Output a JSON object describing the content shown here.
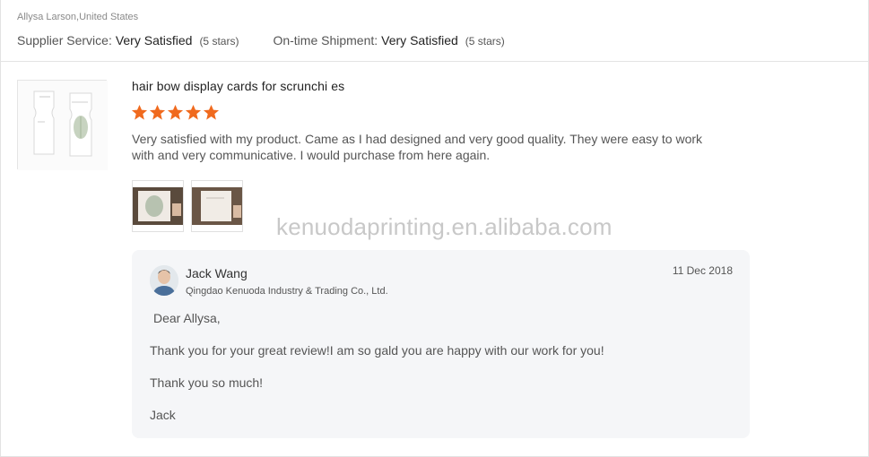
{
  "review": {
    "reviewer": "Allysa Larson,United States",
    "supplier_service_label": "Supplier Service:",
    "supplier_service_value": "Very Satisfied",
    "supplier_service_stars": "(5 stars)",
    "shipment_label": "On-time Shipment:",
    "shipment_value": "Very Satisfied",
    "shipment_stars": "(5 stars)",
    "product_title": "hair bow display cards for scrunchi es",
    "rating": 5,
    "text": "Very satisfied with my product. Came as I had designed and very good quality. They were easy to work with and very communicative. I would purchase from here again.",
    "star_color": "#f06a1e",
    "photo_count": 2
  },
  "watermark": "KENUODAPRINTING.EN.ALIBABA.COM",
  "watermark_text": "kenuodaprinting.en.alibaba.com",
  "reply": {
    "name": "Jack Wang",
    "company": "Qingdao Kenuoda Industry & Trading Co., Ltd.",
    "date": "11 Dec 2018",
    "lines": [
      "Dear Allysa,",
      "Thank you for your great review!I am so gald you are happy with our work for you!",
      "Thank you so much!",
      "Jack"
    ]
  }
}
